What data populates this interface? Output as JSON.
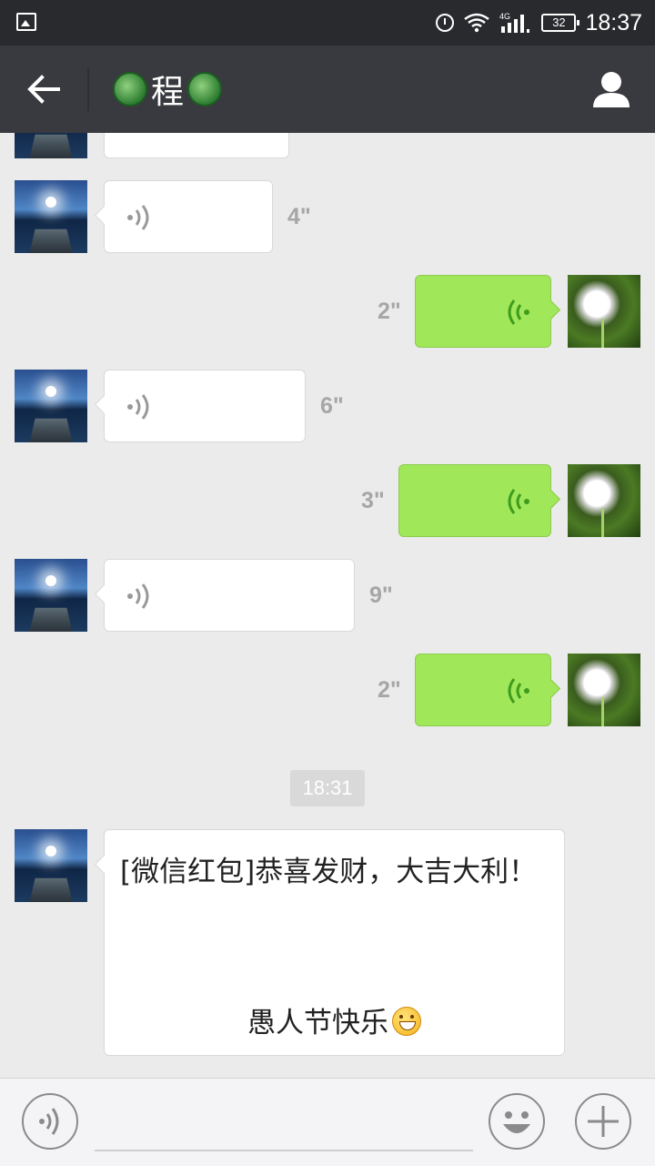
{
  "status_bar": {
    "time": "18:37",
    "network": "4G",
    "battery": "32"
  },
  "header": {
    "title": "程",
    "back_icon": "arrow-left-icon",
    "profile_icon": "person-icon"
  },
  "messages": [
    {
      "side": "left",
      "type": "voice",
      "duration": "",
      "partial": true
    },
    {
      "side": "left",
      "type": "voice",
      "duration": "4\""
    },
    {
      "side": "right",
      "type": "voice",
      "duration": "2\""
    },
    {
      "side": "left",
      "type": "voice",
      "duration": "6\""
    },
    {
      "side": "right",
      "type": "voice",
      "duration": "3\""
    },
    {
      "side": "left",
      "type": "voice",
      "duration": "9\""
    },
    {
      "side": "right",
      "type": "voice",
      "duration": "2\""
    }
  ],
  "timestamp": "18:31",
  "text_message": {
    "line1": "[微信红包]恭喜发财，大吉大利！",
    "line2": "愚人节快乐"
  },
  "input_bar": {
    "voice_icon": "voice-icon",
    "emoji_icon": "smiley-icon",
    "plus_icon": "plus-icon"
  },
  "colors": {
    "sent_bubble": "#a0e75a",
    "title_bar": "#393a3f",
    "status_bar": "#292a2d",
    "chat_bg": "#ebebeb"
  }
}
